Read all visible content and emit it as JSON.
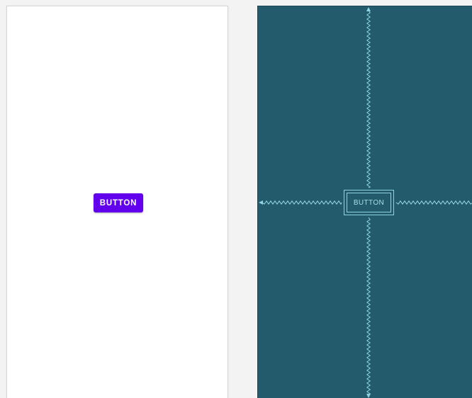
{
  "design_view": {
    "button_label": "BUTTON",
    "button_color": "#6200ee",
    "background": "#ffffff"
  },
  "blueprint_view": {
    "button_label": "BUTTON",
    "background": "#235b6d",
    "line_color": "#8fd3e3"
  }
}
